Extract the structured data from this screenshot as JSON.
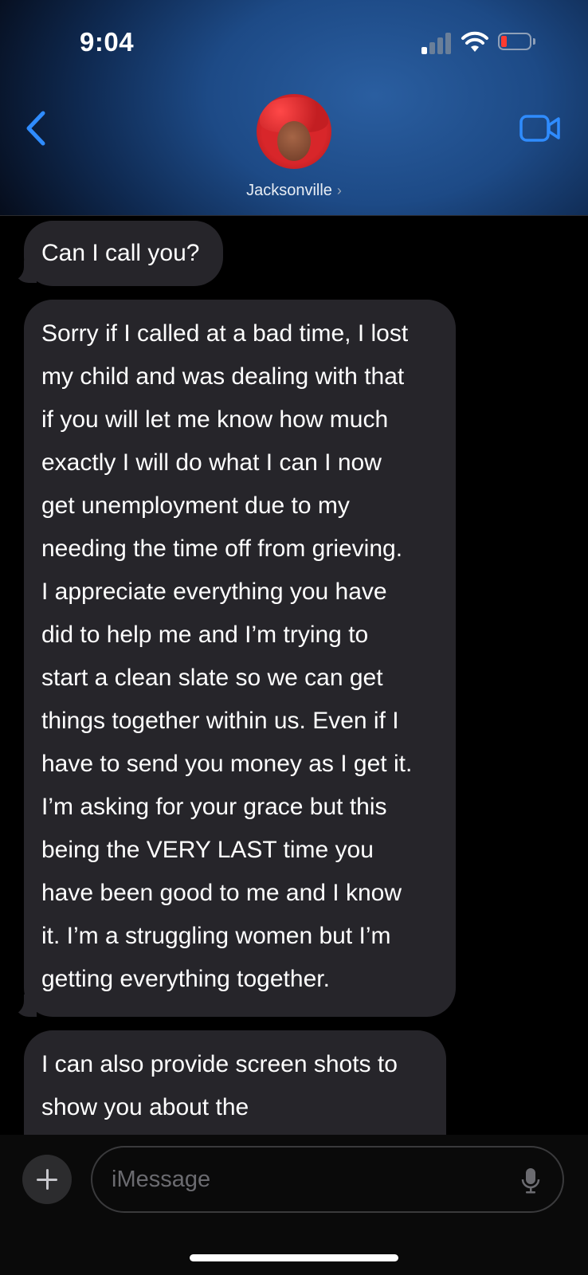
{
  "status_bar": {
    "time": "9:04"
  },
  "header": {
    "contact_name": "Jacksonville",
    "contact_chevron": "›",
    "back_icon": "chevron-left-icon",
    "video_icon": "video-camera-icon",
    "accent_color": "#2f8cff"
  },
  "messages": [
    {
      "text": "Can I call you?"
    },
    {
      "lines": [
        "Sorry if I called at a bad time, I lost",
        "my child and was dealing with that",
        "if you will let me know how much",
        "exactly I will do what I can I now",
        "get unemployment due to my",
        "needing the time off from grieving.",
        "I appreciate everything you have",
        "did to help me and I’m trying to",
        "start a clean slate so we can get",
        "things together within us. Even if I",
        "have to send you money as I get it.",
        "I’m asking for your grace but this",
        "being the VERY LAST time you",
        "have been good to me and I know",
        "it. I’m a struggling women but I’m",
        "getting everything together."
      ]
    },
    {
      "lines": [
        "I can also provide screen shots to",
        "show you about the"
      ]
    }
  ],
  "composer": {
    "placeholder": "iMessage"
  }
}
